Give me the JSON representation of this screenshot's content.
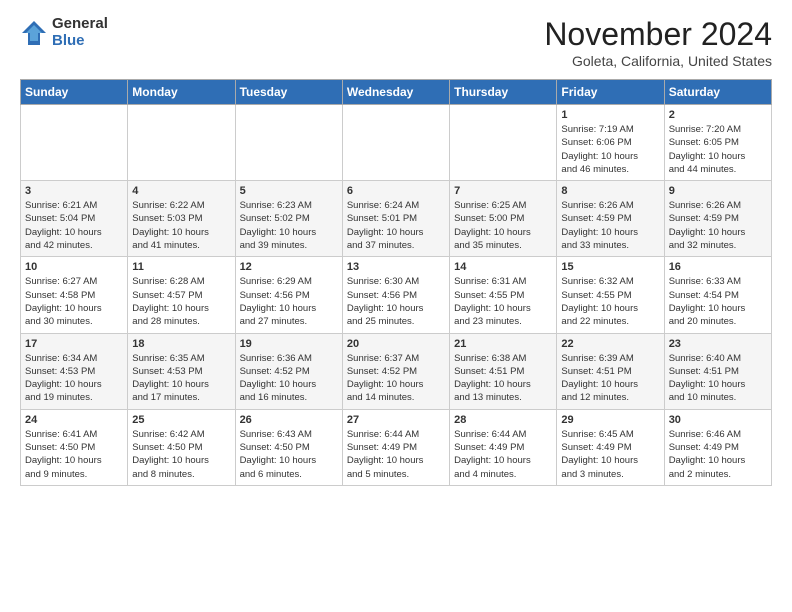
{
  "header": {
    "logo": {
      "general": "General",
      "blue": "Blue"
    },
    "title": "November 2024",
    "location": "Goleta, California, United States"
  },
  "weekdays": [
    "Sunday",
    "Monday",
    "Tuesday",
    "Wednesday",
    "Thursday",
    "Friday",
    "Saturday"
  ],
  "weeks": [
    [
      {
        "day": "",
        "info": ""
      },
      {
        "day": "",
        "info": ""
      },
      {
        "day": "",
        "info": ""
      },
      {
        "day": "",
        "info": ""
      },
      {
        "day": "",
        "info": ""
      },
      {
        "day": "1",
        "info": "Sunrise: 7:19 AM\nSunset: 6:06 PM\nDaylight: 10 hours\nand 46 minutes."
      },
      {
        "day": "2",
        "info": "Sunrise: 7:20 AM\nSunset: 6:05 PM\nDaylight: 10 hours\nand 44 minutes."
      }
    ],
    [
      {
        "day": "3",
        "info": "Sunrise: 6:21 AM\nSunset: 5:04 PM\nDaylight: 10 hours\nand 42 minutes."
      },
      {
        "day": "4",
        "info": "Sunrise: 6:22 AM\nSunset: 5:03 PM\nDaylight: 10 hours\nand 41 minutes."
      },
      {
        "day": "5",
        "info": "Sunrise: 6:23 AM\nSunset: 5:02 PM\nDaylight: 10 hours\nand 39 minutes."
      },
      {
        "day": "6",
        "info": "Sunrise: 6:24 AM\nSunset: 5:01 PM\nDaylight: 10 hours\nand 37 minutes."
      },
      {
        "day": "7",
        "info": "Sunrise: 6:25 AM\nSunset: 5:00 PM\nDaylight: 10 hours\nand 35 minutes."
      },
      {
        "day": "8",
        "info": "Sunrise: 6:26 AM\nSunset: 4:59 PM\nDaylight: 10 hours\nand 33 minutes."
      },
      {
        "day": "9",
        "info": "Sunrise: 6:26 AM\nSunset: 4:59 PM\nDaylight: 10 hours\nand 32 minutes."
      }
    ],
    [
      {
        "day": "10",
        "info": "Sunrise: 6:27 AM\nSunset: 4:58 PM\nDaylight: 10 hours\nand 30 minutes."
      },
      {
        "day": "11",
        "info": "Sunrise: 6:28 AM\nSunset: 4:57 PM\nDaylight: 10 hours\nand 28 minutes."
      },
      {
        "day": "12",
        "info": "Sunrise: 6:29 AM\nSunset: 4:56 PM\nDaylight: 10 hours\nand 27 minutes."
      },
      {
        "day": "13",
        "info": "Sunrise: 6:30 AM\nSunset: 4:56 PM\nDaylight: 10 hours\nand 25 minutes."
      },
      {
        "day": "14",
        "info": "Sunrise: 6:31 AM\nSunset: 4:55 PM\nDaylight: 10 hours\nand 23 minutes."
      },
      {
        "day": "15",
        "info": "Sunrise: 6:32 AM\nSunset: 4:55 PM\nDaylight: 10 hours\nand 22 minutes."
      },
      {
        "day": "16",
        "info": "Sunrise: 6:33 AM\nSunset: 4:54 PM\nDaylight: 10 hours\nand 20 minutes."
      }
    ],
    [
      {
        "day": "17",
        "info": "Sunrise: 6:34 AM\nSunset: 4:53 PM\nDaylight: 10 hours\nand 19 minutes."
      },
      {
        "day": "18",
        "info": "Sunrise: 6:35 AM\nSunset: 4:53 PM\nDaylight: 10 hours\nand 17 minutes."
      },
      {
        "day": "19",
        "info": "Sunrise: 6:36 AM\nSunset: 4:52 PM\nDaylight: 10 hours\nand 16 minutes."
      },
      {
        "day": "20",
        "info": "Sunrise: 6:37 AM\nSunset: 4:52 PM\nDaylight: 10 hours\nand 14 minutes."
      },
      {
        "day": "21",
        "info": "Sunrise: 6:38 AM\nSunset: 4:51 PM\nDaylight: 10 hours\nand 13 minutes."
      },
      {
        "day": "22",
        "info": "Sunrise: 6:39 AM\nSunset: 4:51 PM\nDaylight: 10 hours\nand 12 minutes."
      },
      {
        "day": "23",
        "info": "Sunrise: 6:40 AM\nSunset: 4:51 PM\nDaylight: 10 hours\nand 10 minutes."
      }
    ],
    [
      {
        "day": "24",
        "info": "Sunrise: 6:41 AM\nSunset: 4:50 PM\nDaylight: 10 hours\nand 9 minutes."
      },
      {
        "day": "25",
        "info": "Sunrise: 6:42 AM\nSunset: 4:50 PM\nDaylight: 10 hours\nand 8 minutes."
      },
      {
        "day": "26",
        "info": "Sunrise: 6:43 AM\nSunset: 4:50 PM\nDaylight: 10 hours\nand 6 minutes."
      },
      {
        "day": "27",
        "info": "Sunrise: 6:44 AM\nSunset: 4:49 PM\nDaylight: 10 hours\nand 5 minutes."
      },
      {
        "day": "28",
        "info": "Sunrise: 6:44 AM\nSunset: 4:49 PM\nDaylight: 10 hours\nand 4 minutes."
      },
      {
        "day": "29",
        "info": "Sunrise: 6:45 AM\nSunset: 4:49 PM\nDaylight: 10 hours\nand 3 minutes."
      },
      {
        "day": "30",
        "info": "Sunrise: 6:46 AM\nSunset: 4:49 PM\nDaylight: 10 hours\nand 2 minutes."
      }
    ]
  ]
}
